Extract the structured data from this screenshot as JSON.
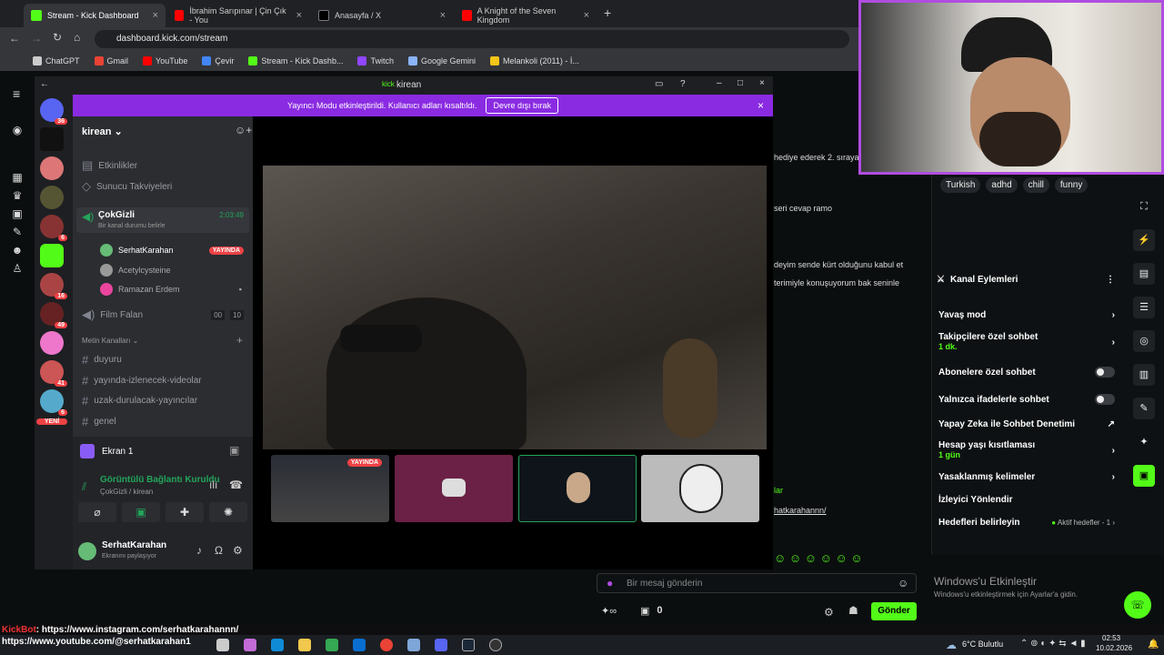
{
  "browser": {
    "tabs": [
      {
        "title": "Stream - Kick Dashboard",
        "color": "#53fc18"
      },
      {
        "title": "İbrahim Sarıpınar | Çin Çık - You",
        "color": "#ff0000"
      },
      {
        "title": "Anasayfa / X",
        "color": "#000000"
      },
      {
        "title": "A Knight of the Seven Kingdom",
        "color": "#ff0000"
      }
    ],
    "url": "dashboard.kick.com/stream",
    "bookmarks": [
      "ChatGPT",
      "Gmail",
      "YouTube",
      "Çevir",
      "Stream - Kick Dashb...",
      "Twitch",
      "Google Gemini",
      "Melankoli (2011) - İ..."
    ]
  },
  "discord": {
    "window_title": "kirean",
    "banner_text": "Yayıncı Modu etkinleştirildi. Kullanıcı adları kısaltıldı.",
    "banner_button": "Devre dışı bırak",
    "server_name": "kirean",
    "top_items": [
      "Etkinlikler",
      "Sunucu Takviyeleri"
    ],
    "voice_channel": {
      "name": "ÇokGizli",
      "timer": "2:03:49",
      "status": "Bir kanal durumu belirle"
    },
    "voice_users": [
      {
        "name": "SerhatKarahan",
        "live": "YAYINDA"
      },
      {
        "name": "Acetylcysteine",
        "live": ""
      },
      {
        "name": "Ramazan Erdem",
        "live": ""
      }
    ],
    "film_channel": {
      "name": "Film Falan",
      "count_a": "00",
      "count_b": "10"
    },
    "text_category": "Metin Kanalları",
    "text_channels": [
      "duyuru",
      "yayında-izlenecek-videolar",
      "uzak-durulacak-yayıncılar",
      "genel"
    ],
    "screen_share": "Ekran 1",
    "connection": {
      "title": "Görüntülü Bağlantı Kuruldu",
      "sub": "ÇokGizli / kirean"
    },
    "user": {
      "name": "SerhatKarahan",
      "status": "Ekranını paylaşıyor"
    },
    "thumb_live": "YAYINDA",
    "guild_badges": [
      "36",
      "6",
      "16",
      "49",
      "41",
      "6",
      "YENİ"
    ]
  },
  "kick": {
    "tags": [
      "Turkish",
      "adhd",
      "chill",
      "funny"
    ],
    "chat_lines": [
      "hediye ederek 2. sıraya y",
      "seri cevap ramo",
      "deyim sende kürt olduğunu kabul et",
      "terimiyle konuşuyorum bak seninle",
      "lar",
      "hatkarahannn/"
    ],
    "channel_actions_title": "Kanal Eylemleri",
    "actions": [
      {
        "label": "Yavaş mod",
        "sub": "",
        "control": "arrow"
      },
      {
        "label": "Takipçilere özel sohbet",
        "sub": "1 dk.",
        "control": "arrow"
      },
      {
        "label": "Abonelere özel sohbet",
        "sub": "",
        "control": "toggle"
      },
      {
        "label": "Yalnızca ifadelerle sohbet",
        "sub": "",
        "control": "toggle"
      },
      {
        "label": "Yapay Zeka ile Sohbet Denetimi",
        "sub": "",
        "control": "external"
      },
      {
        "label": "Hesap yaşı kısıtlaması",
        "sub": "1 gün",
        "control": "arrow"
      },
      {
        "label": "Yasaklanmış kelimeler",
        "sub": "",
        "control": "arrow"
      },
      {
        "label": "İzleyici Yönlendir",
        "sub": "",
        "control": ""
      },
      {
        "label": "Hedefleri belirleyin",
        "sub": "",
        "control": "arrow"
      }
    ],
    "goals_status": "Aktif hedefler - 1",
    "chat_placeholder": "Bir mesaj gönderin",
    "counter": "0",
    "send": "Gönder"
  },
  "windows": {
    "activate_title": "Windows'u Etkinleştir",
    "activate_sub": "Windows'u etkinleştirmek için Ayarlar'a gidin.",
    "overlay_bot": "KickBot",
    "overlay_insta": ": https://www.instagram.com/serhatkarahannn/",
    "overlay_youtube": "https://www.youtube.com/@serhatkarahan1",
    "weather": "6°C Bulutlu",
    "time": "02:53",
    "date": "10.02.2026"
  }
}
